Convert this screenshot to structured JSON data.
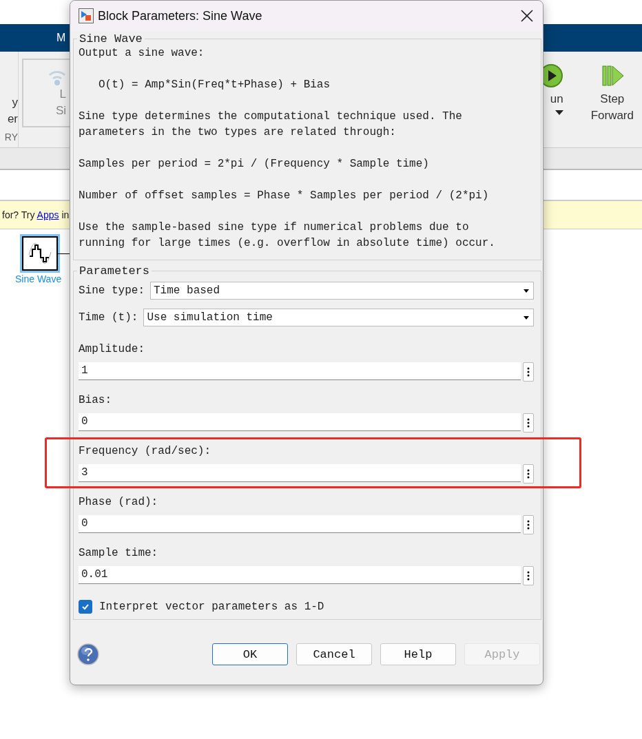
{
  "background": {
    "ribbon_tab": "M",
    "left_labels": [
      "y",
      "er",
      "RY"
    ],
    "disabled_button": {
      "lines": [
        "L",
        "Si"
      ]
    },
    "run": {
      "label": "un"
    },
    "step": {
      "lines": [
        "Step",
        "Forward"
      ]
    },
    "info_bar": {
      "before": "for? Try",
      "link": "Apps",
      "after": "in"
    },
    "block": {
      "label": "Sine Wave",
      "selected": true
    }
  },
  "dialog": {
    "title": "Block Parameters: Sine Wave",
    "description_group": {
      "title": "Sine Wave",
      "paragraphs": [
        {
          "kind": "text",
          "lines": [
            "Output a sine wave:"
          ]
        },
        {
          "kind": "formula",
          "lines": [
            "O(t) = Amp*Sin(Freq*t+Phase) + Bias"
          ]
        },
        {
          "kind": "text",
          "lines": [
            "Sine type determines the computational technique used. The",
            "parameters in the two types are related through:"
          ]
        },
        {
          "kind": "text",
          "lines": [
            "Samples per period = 2*pi / (Frequency * Sample time)"
          ]
        },
        {
          "kind": "text",
          "lines": [
            "Number of offset samples = Phase * Samples per period / (2*pi)"
          ]
        },
        {
          "kind": "text",
          "lines": [
            "Use the sample-based sine type if numerical problems due to",
            "running for large times (e.g. overflow in absolute time) occur."
          ]
        }
      ]
    },
    "parameters_group": {
      "title": "Parameters",
      "dropdowns": [
        {
          "label": "Sine type:",
          "value": "Time based"
        },
        {
          "label": "Time (t):",
          "value": "Use simulation time"
        }
      ],
      "fields": [
        {
          "label": "Amplitude:",
          "value": "1",
          "highlighted": false
        },
        {
          "label": "Bias:",
          "value": "0",
          "highlighted": false
        },
        {
          "label": "Frequency (rad/sec):",
          "value": "3",
          "highlighted": true
        },
        {
          "label": "Phase (rad):",
          "value": "0",
          "highlighted": false
        },
        {
          "label": "Sample time:",
          "value": "0.01",
          "highlighted": false
        }
      ],
      "checkbox": {
        "label": "Interpret vector parameters as 1-D",
        "checked": true
      }
    },
    "buttons": [
      {
        "label": "OK",
        "kind": "default",
        "disabled": false
      },
      {
        "label": "Cancel",
        "kind": "normal",
        "disabled": false
      },
      {
        "label": "Help",
        "kind": "normal",
        "disabled": false
      },
      {
        "label": "Apply",
        "kind": "normal",
        "disabled": true
      }
    ]
  }
}
